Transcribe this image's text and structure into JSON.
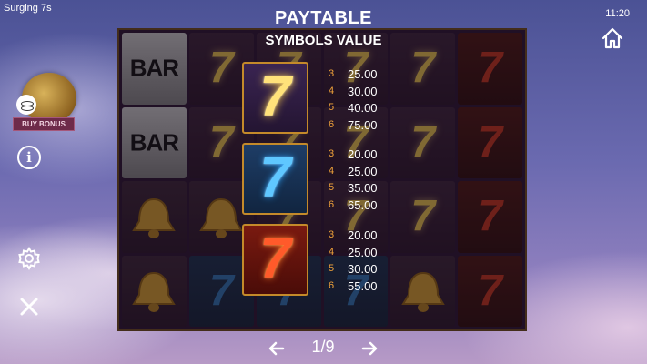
{
  "app": {
    "title": "Surging 7s",
    "clock": "11:20"
  },
  "paytable": {
    "title": "PAYTABLE",
    "subtitle": "SYMBOLS VALUE",
    "groups": [
      {
        "symbol": "gold-seven-icon",
        "rows": [
          {
            "count": "3",
            "value": "25.00"
          },
          {
            "count": "4",
            "value": "30.00"
          },
          {
            "count": "5",
            "value": "40.00"
          },
          {
            "count": "6",
            "value": "75.00"
          }
        ]
      },
      {
        "symbol": "blue-seven-icon",
        "rows": [
          {
            "count": "3",
            "value": "20.00"
          },
          {
            "count": "4",
            "value": "25.00"
          },
          {
            "count": "5",
            "value": "35.00"
          },
          {
            "count": "6",
            "value": "65.00"
          }
        ]
      },
      {
        "symbol": "red-seven-icon",
        "rows": [
          {
            "count": "3",
            "value": "20.00"
          },
          {
            "count": "4",
            "value": "25.00"
          },
          {
            "count": "5",
            "value": "30.00"
          },
          {
            "count": "6",
            "value": "55.00"
          }
        ]
      }
    ]
  },
  "symbols": {
    "seven": "7",
    "bar": "BAR"
  },
  "reels": [
    [
      "bar",
      "gold",
      "gold",
      "gold",
      "gold",
      "red"
    ],
    [
      "bar",
      "gold",
      "gold",
      "gold",
      "gold",
      "red"
    ],
    [
      "bell",
      "bell",
      "gold",
      "gold",
      "gold",
      "red"
    ],
    [
      "bell",
      "blue",
      "blue",
      "blue",
      "bell",
      "red"
    ]
  ],
  "buy_bonus": {
    "label": "BUY BONUS"
  },
  "nav": {
    "page": "1/9"
  },
  "icons": {
    "home": "home-icon",
    "info": "info-icon",
    "settings": "gear-icon",
    "close": "close-icon",
    "prev": "arrow-left-icon",
    "next": "arrow-right-icon"
  },
  "colors": {
    "accent_orange": "#f0a23a",
    "frame_gold": "#c48a2a",
    "buy_bonus_bg": "#6e2b4a"
  }
}
